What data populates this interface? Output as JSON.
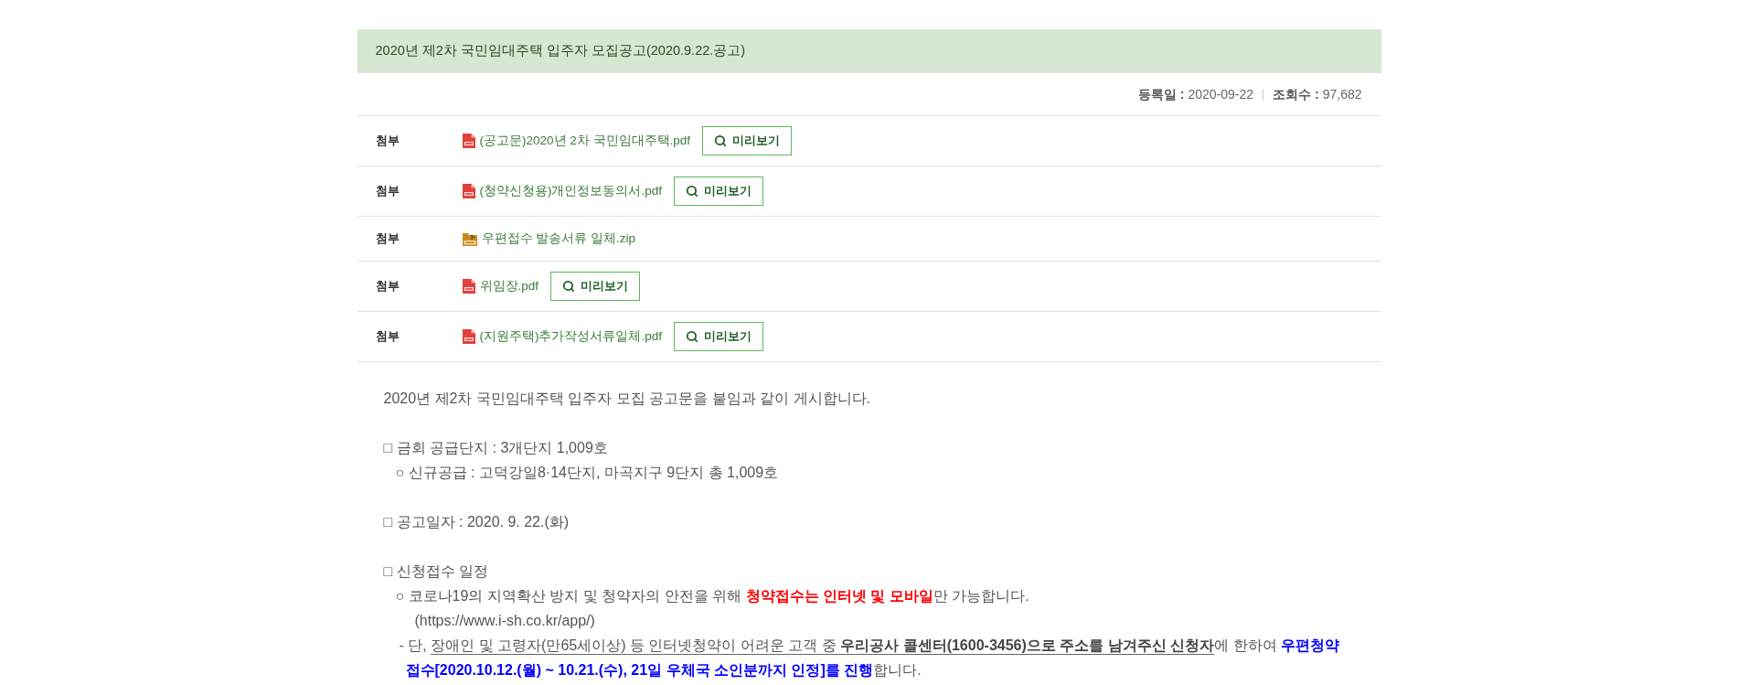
{
  "post": {
    "title": "2020년 제2차 국민임대주택 입주자 모집공고(2020.9.22.공고)",
    "meta": [
      {
        "label": "등록일 :",
        "value": "2020-09-22"
      },
      {
        "label": "조회수 :",
        "value": "97,682"
      }
    ]
  },
  "attachments": [
    {
      "label": "첨부",
      "kind": "pdf",
      "file_name": "(공고문)2020년 2차 국민임대주택.pdf",
      "preview_button": "미리보기"
    },
    {
      "label": "첨부",
      "kind": "pdf",
      "file_name": "(청약신청용)개인정보동의서.pdf",
      "preview_button": "미리보기"
    },
    {
      "label": "첨부",
      "kind": "zip",
      "file_name": "우편접수 발송서류 일체.zip"
    },
    {
      "label": "첨부",
      "kind": "pdf",
      "file_name": "위임장.pdf",
      "preview_button": "미리보기"
    },
    {
      "label": "첨부",
      "kind": "pdf",
      "file_name": "(지원주택)추가작성서류일체.pdf",
      "preview_button": "미리보기"
    }
  ],
  "body": {
    "intro": "2020년 제2차 국민임대주택 입주자 모집 공고문을 붙임과 같이 게시합니다.",
    "sections": [
      {
        "heading": "□ 금회 공급단지 : 3개단지 1,009호",
        "items": [
          {
            "kind": "circle",
            "segments": [
              {
                "text": "○ 신규공급 : 고덕강일8·14단지, 마곡지구 9단지 총 1,009호",
                "kind": "plain"
              }
            ]
          }
        ]
      },
      {
        "heading": "□ 공고일자 : 2020. 9. 22.(화)"
      },
      {
        "heading": "□ 신청접수 일정",
        "items": [
          {
            "kind": "circle",
            "segments": [
              {
                "text": "○ 코로나19의 지역확산 방지 및 청약자의 안전을 위해 ",
                "kind": "plain"
              },
              {
                "text": "청약접수는 인터넷 및 모바일",
                "kind": "alert"
              },
              {
                "text": "만 가능합니다.",
                "kind": "plain"
              }
            ]
          },
          {
            "kind": "url",
            "segments": [
              {
                "text": "(https://www.i-sh.co.kr/app/)",
                "kind": "plain"
              }
            ]
          },
          {
            "kind": "dash",
            "segments": [
              {
                "text": "- 단, ",
                "kind": "plain"
              },
              {
                "text": "장애인 및 고령자(만65세이상) 등 인터넷청약이 어려운 고객 중 ",
                "kind": "underlined"
              },
              {
                "text": "우리공사 콜센터(1600-3456)으로 주소를 남겨주신 신청자",
                "kind": "underlined_strong"
              },
              {
                "text": "에 한하여 ",
                "kind": "plain"
              },
              {
                "text": "우편청약접수[2020.10.12.(월) ~ 10.21.(수), 21일 우체국 소인분까지 인정]를 진행",
                "kind": "highlight"
              },
              {
                "text": "합니다.",
                "kind": "plain"
              }
            ]
          }
        ]
      }
    ]
  }
}
